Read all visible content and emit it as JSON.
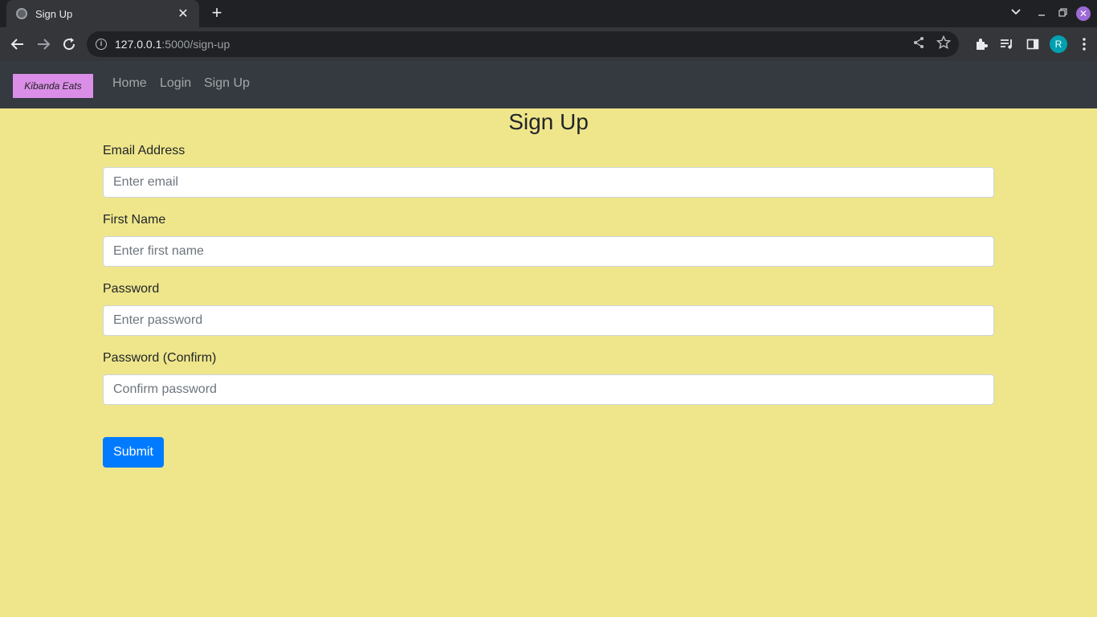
{
  "browser": {
    "tab_title": "Sign Up",
    "url_host": "127.0.0.1",
    "url_path": ":5000/sign-up",
    "profile_initial": "R"
  },
  "navbar": {
    "brand": "Kibanda Eats",
    "links": [
      "Home",
      "Login",
      "Sign Up"
    ]
  },
  "form": {
    "title": "Sign Up",
    "fields": [
      {
        "label": "Email Address",
        "placeholder": "Enter email",
        "value": ""
      },
      {
        "label": "First Name",
        "placeholder": "Enter first name",
        "value": ""
      },
      {
        "label": "Password",
        "placeholder": "Enter password",
        "value": ""
      },
      {
        "label": "Password (Confirm)",
        "placeholder": "Confirm password",
        "value": ""
      }
    ],
    "submit_label": "Submit"
  },
  "colors": {
    "page_background": "#efe68b",
    "navbar_background": "#343a40",
    "brand_background": "#da8ee7",
    "submit_button": "#007bff"
  },
  "icons": [
    "globe-icon",
    "close-icon",
    "plus-icon",
    "chevron-down-icon",
    "minimize-icon",
    "restore-icon",
    "back-arrow-icon",
    "forward-arrow-icon",
    "reload-icon",
    "info-icon",
    "share-icon",
    "star-icon",
    "puzzle-icon",
    "media-queue-icon",
    "side-panel-icon",
    "kebab-menu-icon"
  ]
}
